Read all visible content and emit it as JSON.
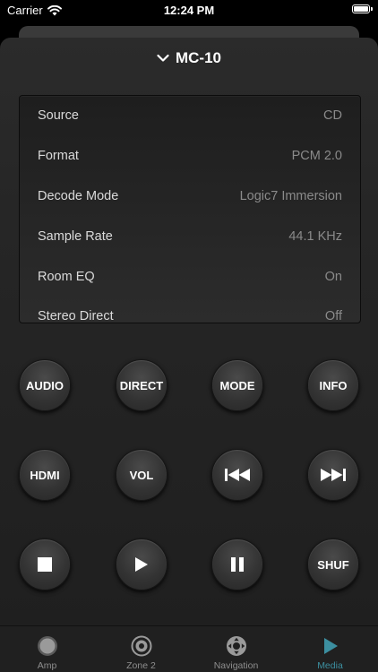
{
  "status_bar": {
    "carrier": "Carrier",
    "time": "12:24 PM"
  },
  "header": {
    "title": "MC-10"
  },
  "info": [
    {
      "label": "Source",
      "value": "CD"
    },
    {
      "label": "Format",
      "value": "PCM 2.0"
    },
    {
      "label": "Decode Mode",
      "value": "Logic7 Immersion"
    },
    {
      "label": "Sample Rate",
      "value": "44.1 KHz"
    },
    {
      "label": "Room EQ",
      "value": "On"
    },
    {
      "label": "Stereo Direct",
      "value": "Off"
    }
  ],
  "buttons": {
    "audio": "AUDIO",
    "direct": "DIRECT",
    "mode": "MODE",
    "info": "INFO",
    "hdmi": "HDMI",
    "vol": "VOL",
    "shuf": "SHUF"
  },
  "icons": {
    "previous": "previous-track-icon",
    "next": "next-track-icon",
    "stop": "stop-icon",
    "play": "play-icon",
    "pause": "pause-icon"
  },
  "tabs": [
    {
      "label": "Amp",
      "icon": "amp-icon"
    },
    {
      "label": "Zone 2",
      "icon": "zone2-icon"
    },
    {
      "label": "Navigation",
      "icon": "navigation-icon"
    },
    {
      "label": "Media",
      "icon": "media-icon"
    }
  ],
  "colors": {
    "accent": "#3c8fa0",
    "background": "#000000",
    "panel": "#252525"
  }
}
